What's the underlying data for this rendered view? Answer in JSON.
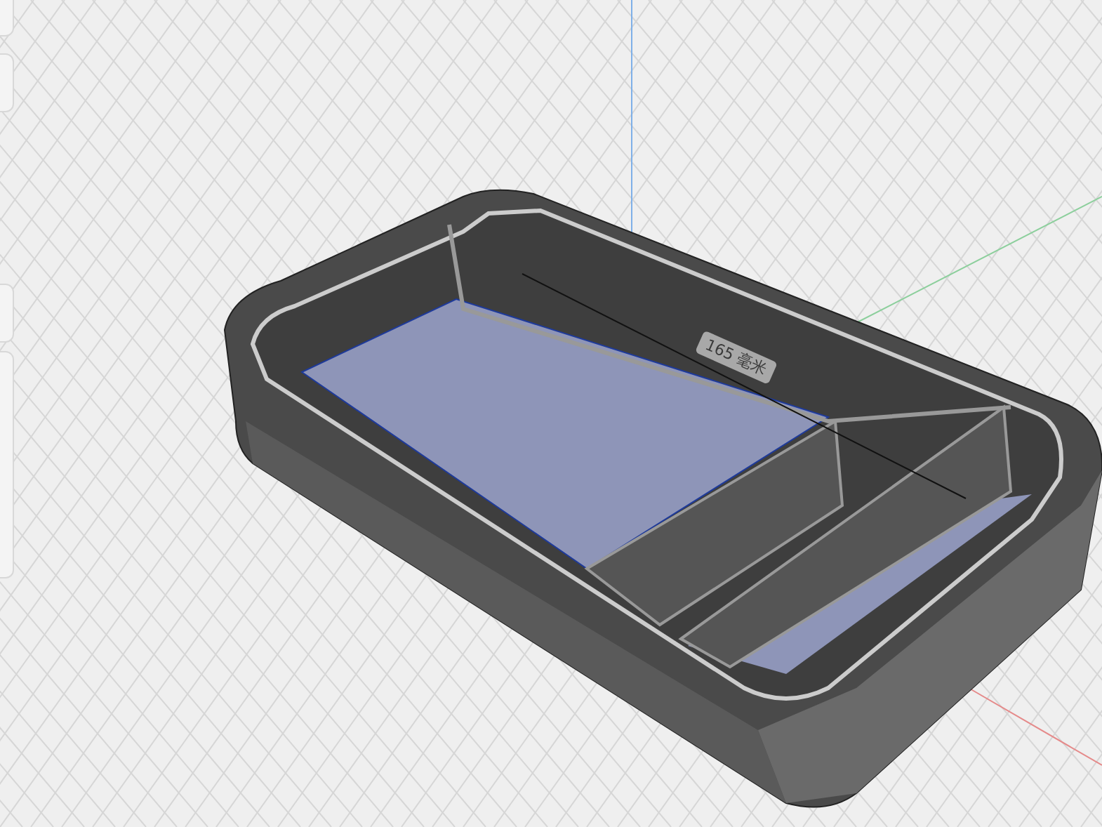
{
  "viewport": {
    "dimension": {
      "label": "165 毫米"
    }
  }
}
